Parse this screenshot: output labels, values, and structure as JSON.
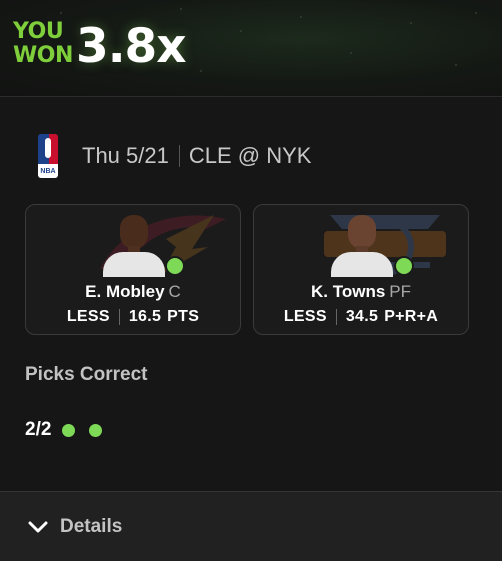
{
  "banner": {
    "you": "YOU",
    "won": "WON",
    "multiplier": "3.8x",
    "accent_color": "#7ecf3b"
  },
  "game": {
    "league_icon": "nba-logo-icon",
    "league_short": "NBA",
    "date": "Thu 5/21",
    "matchup": "CLE @ NYK"
  },
  "picks": [
    {
      "name": "E. Mobley",
      "position": "C",
      "direction": "LESS",
      "line": "16.5",
      "stat": "PTS",
      "team_logo": "cavaliers-logo-icon",
      "status": "hit",
      "status_color": "#7ed957"
    },
    {
      "name": "K. Towns",
      "position": "PF",
      "direction": "LESS",
      "line": "34.5",
      "stat": "P+R+A",
      "team_logo": "knicks-logo-icon",
      "status": "hit",
      "status_color": "#7ed957"
    }
  ],
  "summary": {
    "title": "Picks Correct",
    "count": "2/2",
    "correct": 2,
    "total": 2
  },
  "details": {
    "label": "Details",
    "icon": "chevron-down-icon"
  }
}
